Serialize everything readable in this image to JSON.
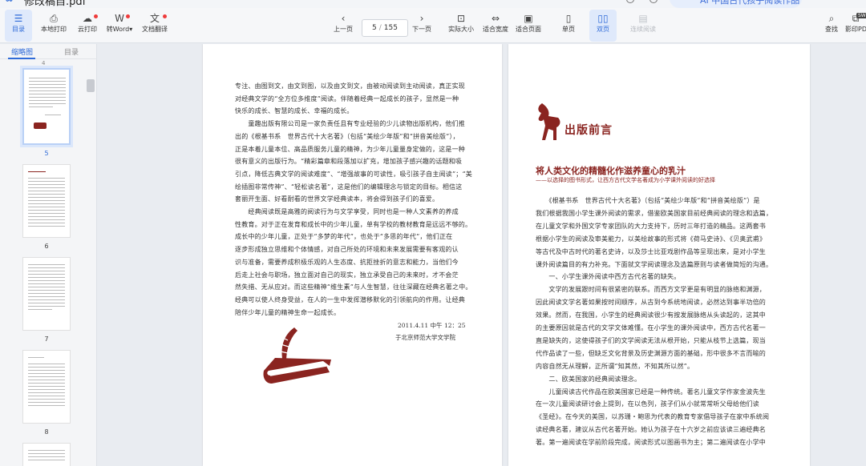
{
  "window": {
    "file_name": "修改稿自.pdf",
    "promo_text": "AI 中国古代孩子阅读作品"
  },
  "toolbar": {
    "items": [
      {
        "label": "目录",
        "glyph": "☰",
        "active": true
      },
      {
        "label": "本地打印",
        "glyph": "⎙"
      },
      {
        "label": "云打印",
        "glyph": "☁",
        "dot": true
      },
      {
        "label": "转Word",
        "glyph": "W",
        "dot": true,
        "caret": "▾"
      },
      {
        "label": "文档翻译",
        "glyph": "文",
        "dot": true
      },
      {
        "label": "上一页",
        "glyph": "‹"
      },
      {
        "label": "下一页",
        "glyph": "›"
      },
      {
        "label": "实际大小",
        "glyph": "⊡"
      },
      {
        "label": "适合宽度",
        "glyph": "⇔"
      },
      {
        "label": "适合页面",
        "glyph": "▣"
      },
      {
        "label": "单页",
        "glyph": "▯"
      },
      {
        "label": "双页",
        "glyph": "▯▯",
        "active": true
      },
      {
        "label": "连续阅读",
        "glyph": "▤",
        "disabled": true
      },
      {
        "label": "查找",
        "glyph": "⌕"
      },
      {
        "label": "影印PDF",
        "glyph": "⧉"
      }
    ],
    "current_page": "5",
    "total_pages": "155",
    "page_sep": "/",
    "new_badge": "SW"
  },
  "sidebar": {
    "tabs": [
      "缩略图",
      "目录"
    ],
    "active_tab": "缩略图",
    "top_num": "4",
    "thumbnails": [
      {
        "num": "5",
        "selected": true
      },
      {
        "num": "6"
      },
      {
        "num": "7"
      },
      {
        "num": "8"
      }
    ]
  },
  "left_page": {
    "paragraphs": [
      "专注、由图到文，由文到图，以及由文到文，由被动阅读到主动阅读，真正实现",
      "对经典文学的“全方位多维度”阅读。伴随着经典一起成长的孩子，显然是一种",
      "快乐的成长、智慧的成长、幸福的成长。",
      "　　童趣出版有限公司是一家负责任且有专业经验的少儿读物出版机构，他们推",
      "出的《根基书系　世界古代十大名著》（包括“美绘少年版”和“拼音美绘版”），",
      "正是本着儿童本位、高品质服务儿童的精神，为少年儿童量身定做的，这是一种",
      "很有意义的出版行为。“精彩篇章和段落加以扩充，增加孩子感兴趣的话题和吸",
      "引点，降低古典文学的阅读难度”、“增强故事的可读性，吸引孩子自主阅读”；“美",
      "绘插图非常传神”、“轻松读名著”，这是他们的编辑理念与锁定的目标。相信这",
      "套丽开生面、好看耐看的世界文学经典读本，将会得到孩子们的喜爱。",
      "　　经典阅读既是高雅的阅读行为与文学享受，同时也是一种人文素养的养成",
      "性教育。对于正在发育和成长中的少年儿童，单有学校的教材教育是远远不够的。",
      "成长中的少年儿童，正处于“多梦的年代”，也处于“多思的年代”，他们正在",
      "逐步形成独立思维和个体情感，对自己所处的环境和未来发展需要有客观的认",
      "识与准备，需要养成积极乐观的人生态度、抗拒挫折的意志和能力，当他们今",
      "后走上社会与职场，独立面对自己的现实，独立承受自己的未来时，才不会茫",
      "然失措、无从应对。而这些精神“维生素”与人生智慧，往往深藏在经典名著之中。",
      "经典可以使人终身受益，在人的一生中发挥潜移默化的引领航向的作用。让经典",
      "陪伴少年儿童的精神生命一起成长。"
    ],
    "date": "2011.4.11 中午 12：25",
    "place": "于北京师范大学文学院"
  },
  "right_page": {
    "heading": "出版前言",
    "title": "将人类文化的精髓化作滋养童心的乳汁",
    "subtitle": "——以选择的图书形式，让西方古代文学名著成为小学课外阅读的好选择",
    "paragraphs": [
      "　　《根基书系　世界古代十大名著》（包括“美绘少年版”和“拼音美绘版”）是",
      "我们根据我国小学生课外阅读的需求，借鉴欧美国家目前经典阅读的理念和选篇，",
      "在儿童文学和外国文学专家团队的大力支持下，历时三年打造的精品。这两套书",
      "根据小学生的阅读及审美能力，以美绘故事的形式将《荷马史诗》、《贝奥武甫》",
      "等古代及中古时代的著名史诗，以及莎士比亚戏剧作品等呈现出来，是对小学生",
      "课外阅读篇目的有力补充。下面就文学阅读理念及选篇原则与读者做简短的沟通。",
      "　　一、小学生课外阅读中西方古代名著的缺失。",
      "　　文学的发展跟时间有很紧密的联系。而西方文学更是有明显的脉络和渊源，",
      "因此阅读文学名著如果按时间顺序，从古到今系统地阅读，必然达到事半功倍的",
      "效果。然而，在我国，小学生的经典阅读很少有按发展脉络从头读起的，这其中",
      "的主要原因就是古代的文学文体难懂。在小学生的课外阅读中，西方古代名著一",
      "直是缺失的，这使得孩子们的文学阅读无法从根开始，只能从枝节上选篇，现当",
      "代作品读了一些，但缺乏文化背景及历史渊源方面的基础，形中很多不言而喻的",
      "内容自然无从理解，正所谓“知其然，不知其所以然”。",
      "　　二、欧美国家的经典阅读理念。",
      "　　儿童阅读古代作品在欧美国家已经是一种传统。著名儿童文学作家金波先生",
      "在一次儿童阅读研讨会上提到，在以色列，孩子们从小就常常听父母给他们读",
      "《圣经》。在今天的美国，以苏珊・鲍思为代表的教育专家倡导孩子在家中系统阅",
      "读经典名著，建议从古代名著开始。她认为孩子在十六岁之前应该读三遍经典名",
      "著。第一遍阅读在学前阶段完成，阅读形式以图画书为主；第二遍阅读在小学中"
    ]
  }
}
